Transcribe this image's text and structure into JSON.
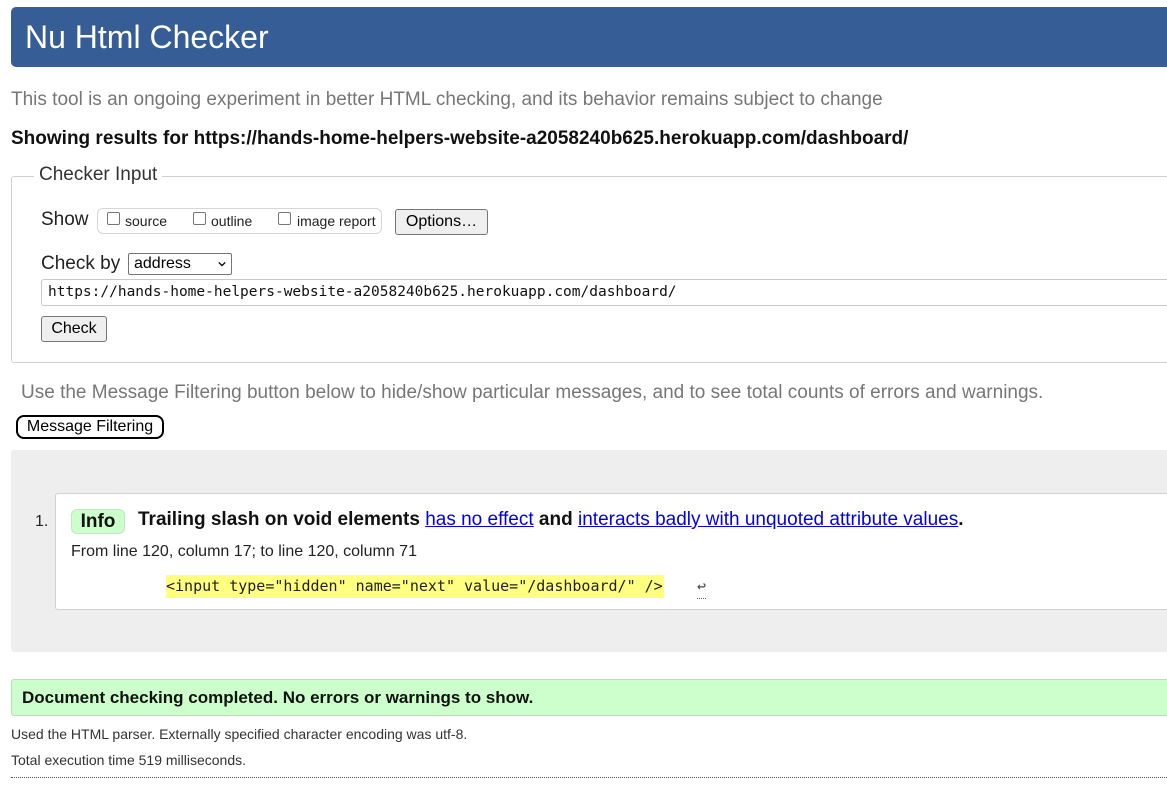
{
  "header": {
    "title": "Nu Html Checker"
  },
  "intro": "This tool is an ongoing experiment in better HTML checking, and its behavior remains subject to change",
  "showing_results": "Showing results for https://hands-home-helpers-website-a2058240b625.herokuapp.com/dashboard/",
  "checker_input": {
    "legend": "Checker Input",
    "show_label": "Show",
    "options": [
      {
        "label": "source",
        "checked": false
      },
      {
        "label": "outline",
        "checked": false
      },
      {
        "label": "image report",
        "checked": false
      }
    ],
    "options_button": "Options…",
    "check_by_label": "Check by",
    "check_by_value": "address",
    "url_value": "https://hands-home-helpers-website-a2058240b625.herokuapp.com/dashboard/",
    "check_button": "Check"
  },
  "filter_note": "Use the Message Filtering button below to hide/show particular messages, and to see total counts of errors and warnings.",
  "filter_button": "Message Filtering",
  "messages": [
    {
      "number": "1.",
      "type": "Info",
      "text_before": "Trailing slash on void elements ",
      "link1": "has no effect",
      "text_middle": " and ",
      "link2": "interacts badly with unquoted attribute values",
      "text_after": ".",
      "location": "From line 120, column 17; to line 120, column 71",
      "extract": "<input type=\"hidden\" name=\"next\" value=\"/dashboard/\" />",
      "line_feed_symbol": "↩"
    }
  ],
  "completion": "Document checking completed. No errors or warnings to show.",
  "parser_note": "Used the HTML parser. Externally specified character encoding was utf-8.",
  "timing_note": "Total execution time 519 milliseconds.",
  "colors": {
    "header_bg": "#365d95",
    "info_badge": "#ccffcc",
    "success_bg": "#ccffcc",
    "extract_highlight": "#ffff80",
    "link": "#0000ee"
  }
}
